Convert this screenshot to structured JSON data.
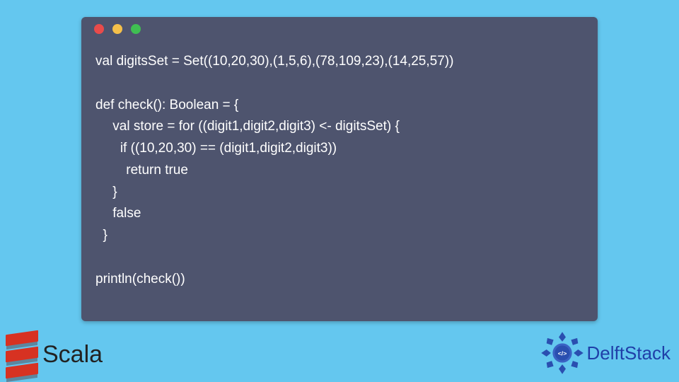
{
  "code": {
    "lines": [
      "val digitsSet = Set((10,20,30),(1,5,6),(78,109,23),(14,25,57))",
      "",
      "def check(): Boolean = {",
      "  val store = for ((digit1,digit2,digit3) <- digitsSet) {",
      "    if ((10,20,30) == (digit1,digit2,digit3))",
      "   return true",
      "  }",
      "  false",
      "  }",
      "",
      "println(check())"
    ]
  },
  "brand_left": {
    "name": "Scala"
  },
  "brand_right": {
    "name": "DelftStack"
  },
  "icons": {
    "close": "red-dot",
    "minimize": "yellow-dot",
    "zoom": "green-dot"
  }
}
